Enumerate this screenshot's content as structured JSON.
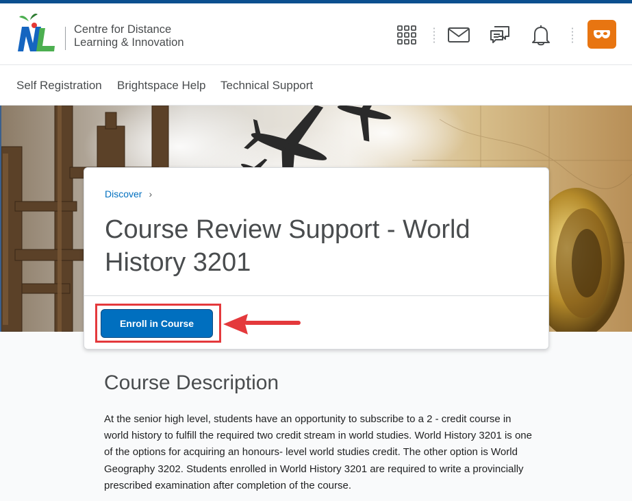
{
  "header": {
    "org_line1": "Centre for Distance",
    "org_line2": "Learning & Innovation",
    "icons": [
      "apps-grid-icon",
      "mail-icon",
      "chat-icon",
      "bell-icon",
      "user-avatar-icon"
    ],
    "avatar_color": "#e87511"
  },
  "nav": {
    "items": [
      "Self Registration",
      "Brightspace Help",
      "Technical Support"
    ]
  },
  "card": {
    "breadcrumb": "Discover",
    "breadcrumb_sep": "›",
    "title": "Course Review Support - World History 3201",
    "enroll_label": "Enroll in Course"
  },
  "description": {
    "heading": "Course Description",
    "text": "At the senior high level, students have an opportunity to subscribe to a 2 - credit course in world history to fulfill the required two credit stream in world studies. World History 3201 is one of the options for acquiring an honours- level world studies credit. The other option is World Geography 3202. Students enrolled in World History 3201 are required to write a provincially prescribed examination after completion of the course."
  },
  "colors": {
    "brand_blue": "#006fbf",
    "highlight_red": "#e4393c",
    "header_stripe": "#0b4f8f"
  }
}
